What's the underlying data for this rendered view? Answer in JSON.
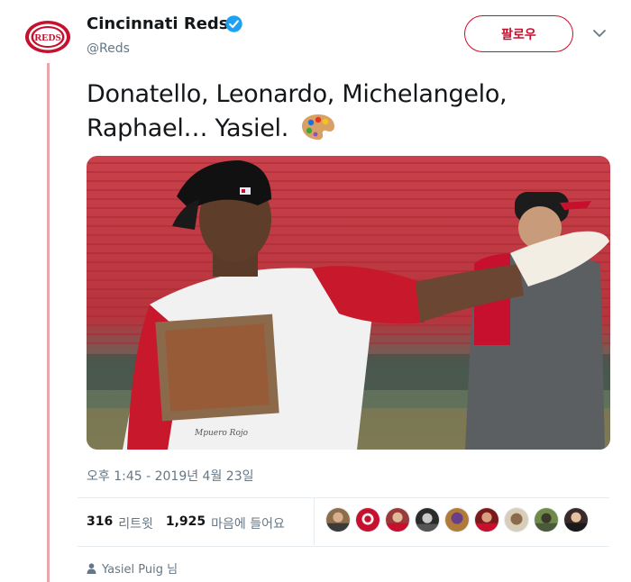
{
  "account": {
    "name": "Cincinnati Reds",
    "handle": "@Reds",
    "avatar_text": "REDS",
    "verified": true,
    "brand_color": "#c6102e"
  },
  "follow_button": {
    "label": "팔로우"
  },
  "tweet": {
    "text": "Donatello, Leonardo, Michelangelo, Raphael… Yasiel.",
    "emoji_icon": "artist-palette-icon",
    "photo_shirt_caption": "Mpuero Rojo"
  },
  "timestamp": "오후 1:45 - 2019년 4월 23일",
  "stats": {
    "retweets_count": "316",
    "retweets_label": "리트윗",
    "likes_count": "1,925",
    "likes_label": "마음에 들어요",
    "likers_shown": 9
  },
  "social_context": {
    "text": "Yasiel Puig 님",
    "icon": "person-icon"
  }
}
